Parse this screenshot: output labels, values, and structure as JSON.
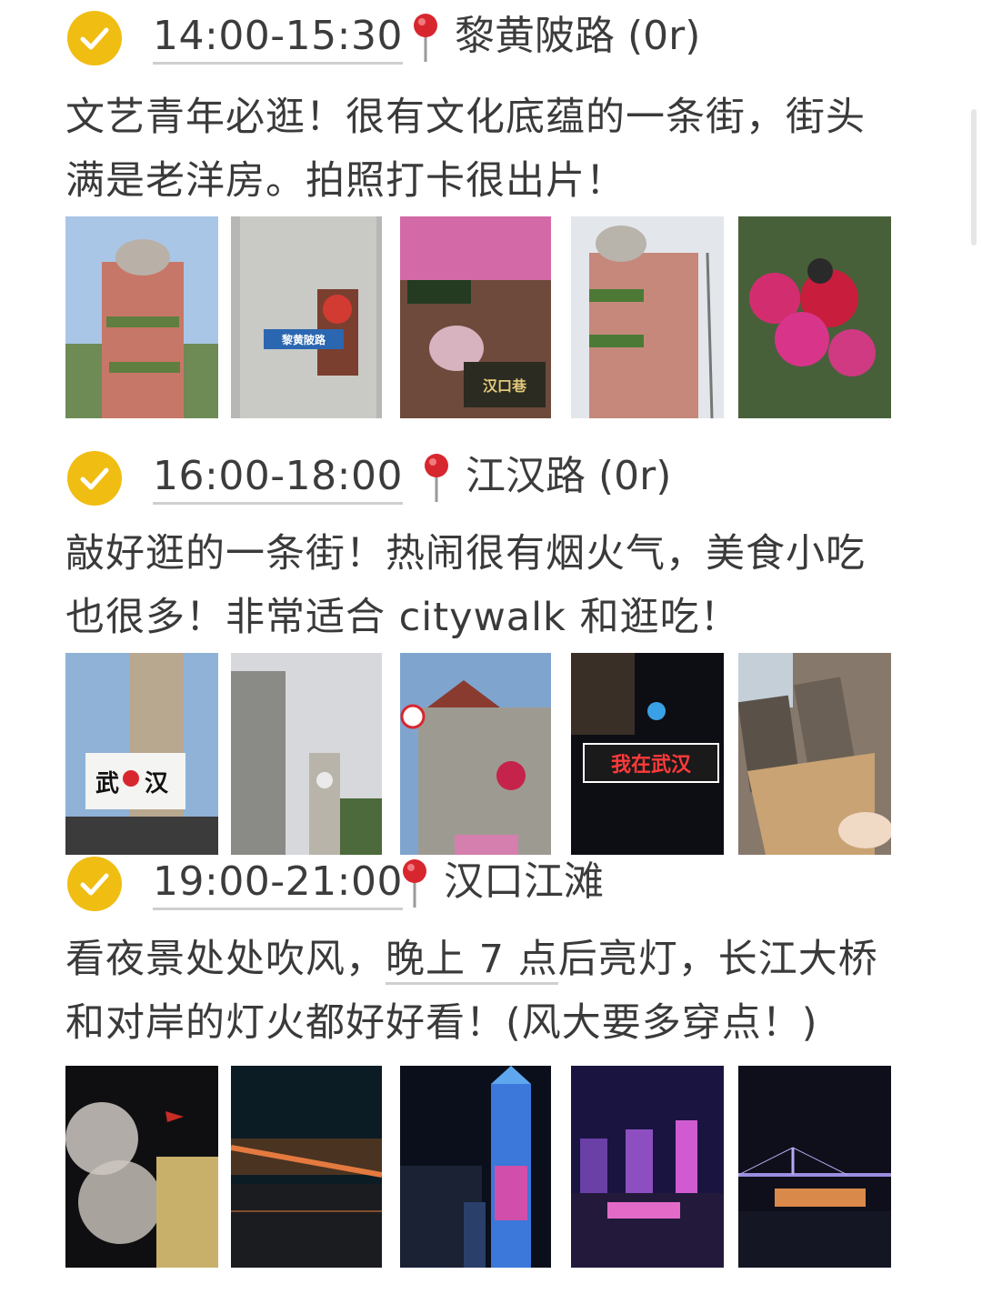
{
  "sections": [
    {
      "time": "14:00-15:30",
      "place": "黎黄陂路 (0r)",
      "desc_line1": "文艺青年必逛！很有文化底蕴的一条街，街头",
      "desc_line2": "满是老洋房。拍照打卡很出片！",
      "photo_text": [
        "黎黄陂路",
        "汉口巷"
      ]
    },
    {
      "time": "16:00-18:00",
      "place": "江汉路 (0r)",
      "desc_line1": "敲好逛的一条街！热闹很有烟火气，美食小吃",
      "desc_line2": "也很多！非常适合 citywalk 和逛吃！",
      "photo_text": [
        "武",
        "汉",
        "我在武汉"
      ]
    },
    {
      "time": "19:00-21:00",
      "place": "汉口江滩",
      "desc_line1_pre": "看夜景处处吹风，",
      "desc_line1_u": "晚上 7 点",
      "desc_line1_post": "后亮灯，长江大桥",
      "desc_line2": "和对岸的灯火都好好看！(风大要多穿点！)"
    }
  ],
  "colors": {
    "check": "#f0bd12",
    "pin": "#d8262f",
    "text": "#3a3a3a"
  },
  "icons": {
    "check": "check-circle-icon",
    "pin": "location-pin-icon"
  }
}
